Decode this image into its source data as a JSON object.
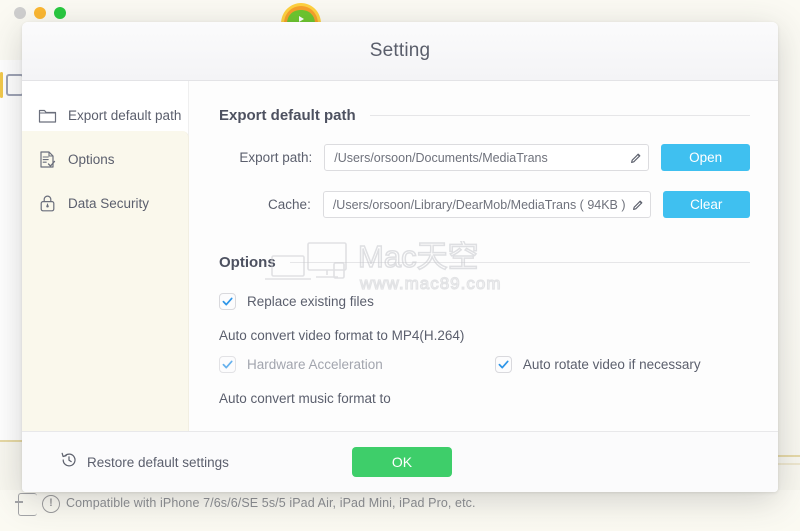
{
  "background_app": {
    "traffic_lights": [
      "close",
      "minimize",
      "zoom"
    ],
    "logo_icon": "dearmob-logo-icon",
    "status_text": "Compatible with iPhone 7/6s/6/SE 5s/5 iPad Air, iPad Mini, iPad Pro, etc.",
    "status_icon": "warning-icon",
    "device_icon": "device-icon"
  },
  "dialog": {
    "title": "Setting",
    "sidebar": {
      "items": [
        {
          "label": "Export default path",
          "icon": "folder-icon",
          "selected": true
        },
        {
          "label": "Options",
          "icon": "document-check-icon",
          "selected": false
        },
        {
          "label": "Data Security",
          "icon": "lock-icon",
          "selected": false
        }
      ]
    },
    "sections": [
      {
        "title": "Export default path",
        "fields": [
          {
            "label": "Export path:",
            "value": "/Users/orsoon/Documents/MediaTrans",
            "edit_icon": "pencil-icon",
            "button": "Open"
          },
          {
            "label": "Cache:",
            "value": "/Users/orsoon/Library/DearMob/MediaTrans ( 94KB )",
            "edit_icon": "pencil-icon",
            "button": "Clear"
          }
        ]
      },
      {
        "title": "Options",
        "checkboxes": [
          {
            "label": "Replace existing files",
            "checked": true,
            "dim": false
          }
        ],
        "video_heading": "Auto convert video format to MP4(H.264)",
        "video_options": [
          {
            "label": "Hardware Acceleration",
            "checked": true,
            "dim": true
          },
          {
            "label": "Auto rotate video if necessary",
            "checked": true,
            "dim": false
          }
        ],
        "music_heading": "Auto convert music format to"
      }
    ],
    "footer": {
      "restore_label": "Restore default settings",
      "restore_icon": "restore-clock-icon",
      "ok_label": "OK"
    }
  },
  "watermark": {
    "brand": "Mac天空",
    "url": "www.mac89.com"
  },
  "colors": {
    "accent_blue": "#3fc0f0",
    "accent_green": "#3ece6a",
    "sidebar_cream": "#faf8ec",
    "text": "#5b5f6d"
  }
}
